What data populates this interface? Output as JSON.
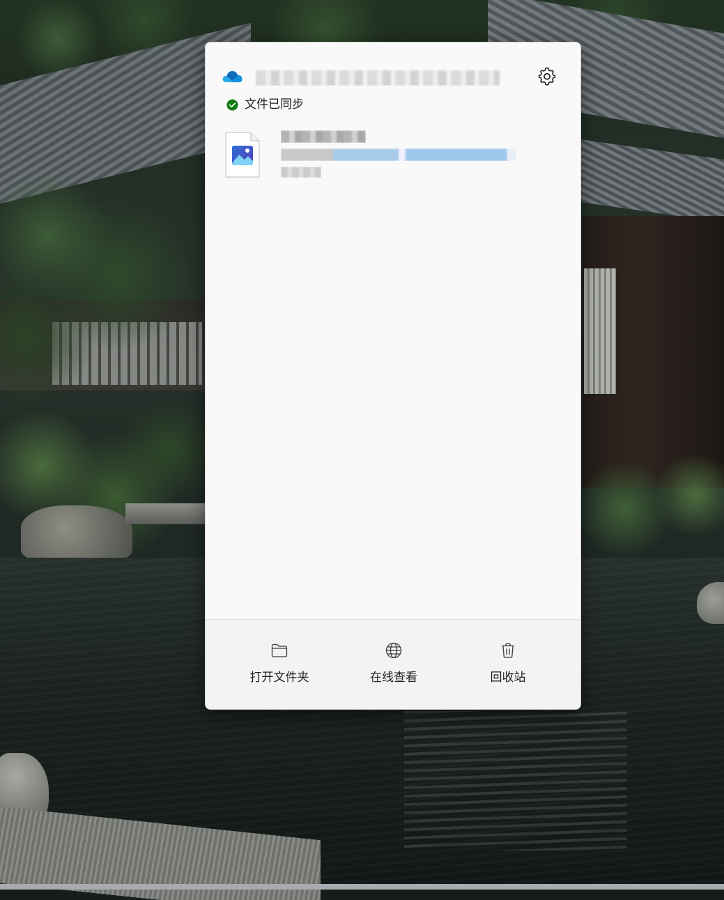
{
  "flyout": {
    "account_name": "",
    "status_text": "文件已同步",
    "settings_icon": "gear-icon",
    "cloud_icon": "onedrive-cloud-icon",
    "accent_color": "#0f6cbd",
    "status_color": "#0f7b0f"
  },
  "recent_files": [
    {
      "name": "",
      "location": "",
      "time": "",
      "icon": "image-file-icon"
    }
  ],
  "footer": {
    "open_folder_label": "打开文件夹",
    "view_online_label": "在线查看",
    "recycle_bin_label": "回收站"
  }
}
